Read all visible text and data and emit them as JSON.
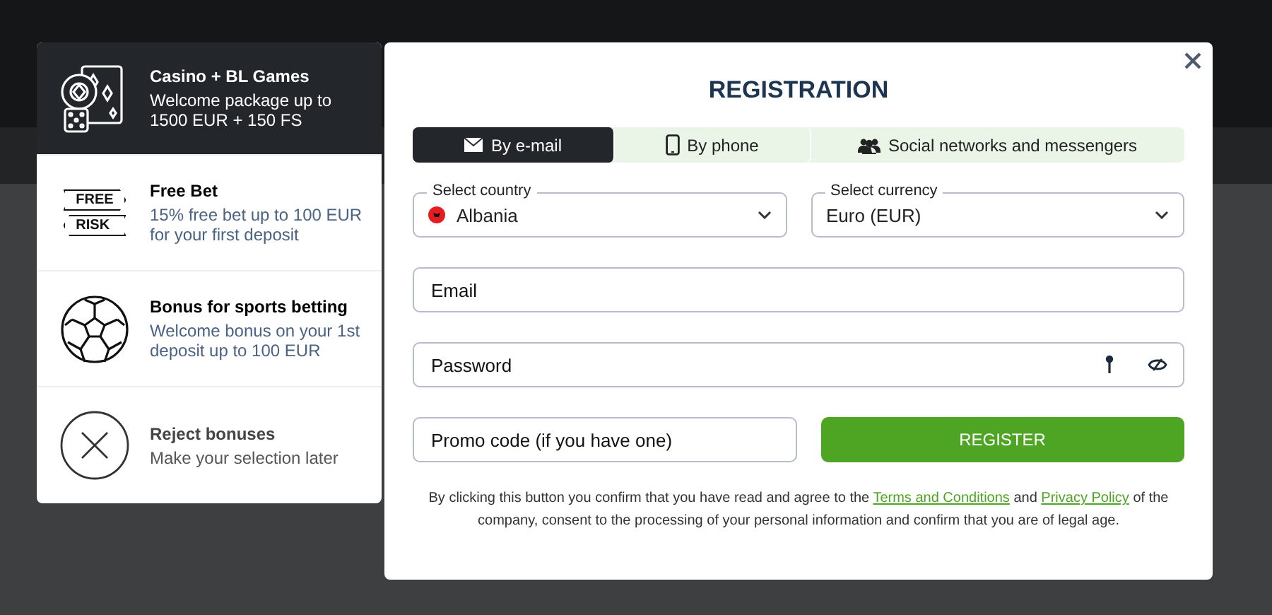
{
  "bonuses": [
    {
      "kind": "casino",
      "title": "Casino + BL Games",
      "description": "Welcome package up to 1500 EUR + 150 FS",
      "selected": true
    },
    {
      "kind": "freebet",
      "title": "Free Bet",
      "description": "15% free bet up to 100 EUR for your first deposit",
      "selected": false,
      "badges": [
        "FREE",
        "RISK"
      ]
    },
    {
      "kind": "sports",
      "title": "Bonus for sports betting",
      "description": "Welcome bonus on your 1st deposit up to 100 EUR",
      "selected": false
    },
    {
      "kind": "reject",
      "title": "Reject bonuses",
      "description": "Make your selection later",
      "selected": false
    }
  ],
  "registration": {
    "title": "REGISTRATION",
    "tabs": [
      {
        "kind": "email",
        "label": "By e-mail",
        "selected": true
      },
      {
        "kind": "phone",
        "label": "By phone",
        "selected": false
      },
      {
        "kind": "social",
        "label": "Social networks and messengers",
        "selected": false
      }
    ],
    "country": {
      "label": "Select country",
      "value": "Albania"
    },
    "currency": {
      "label": "Select currency",
      "value": "Euro (EUR)"
    },
    "email": {
      "placeholder": "Email"
    },
    "password": {
      "placeholder": "Password"
    },
    "promo": {
      "placeholder": "Promo code (if you have one)"
    },
    "register_button": "REGISTER",
    "terms": [
      {
        "kind": "text",
        "text": "By clicking this button you confirm that you have read and agree to the "
      },
      {
        "kind": "link",
        "text": "Terms and Conditions"
      },
      {
        "kind": "text",
        "text": " and "
      },
      {
        "kind": "link",
        "text": "Privacy Policy"
      },
      {
        "kind": "text",
        "text": " of the company, consent to the processing of your personal information and confirm that you are of legal age."
      }
    ]
  }
}
